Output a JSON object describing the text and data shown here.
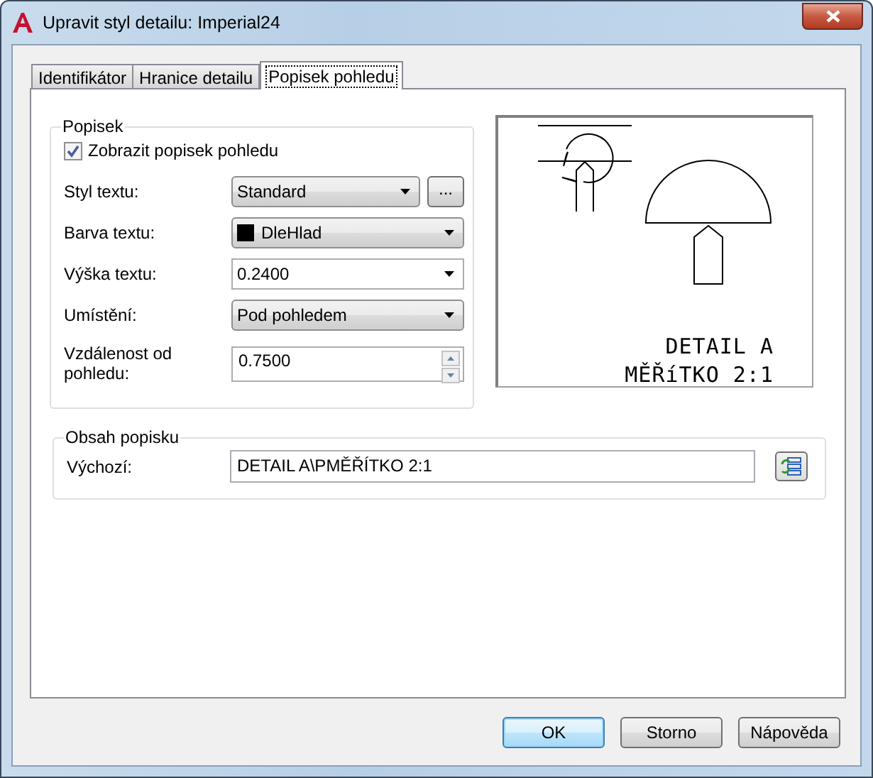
{
  "window": {
    "title": "Upravit styl detailu: Imperial24"
  },
  "tabs": [
    {
      "label": "Identifikátor",
      "selected": false
    },
    {
      "label": "Hranice detailu",
      "selected": false
    },
    {
      "label": "Popisek pohledu",
      "selected": true
    }
  ],
  "label_group": {
    "title": "Popisek",
    "show_label": {
      "label": "Zobrazit popisek pohledu",
      "checked": true
    },
    "rows": [
      {
        "kind": "combo",
        "label": "Styl textu:",
        "value": "Standard",
        "browse_button": "..."
      },
      {
        "kind": "combo",
        "label": "Barva textu:",
        "value": "DleHlad",
        "color": "#000000"
      },
      {
        "kind": "editable-combo",
        "label": "Výška textu:",
        "value": "0.2400"
      },
      {
        "kind": "combo",
        "label": "Umístění:",
        "value": "Pod pohledem"
      },
      {
        "kind": "spinner",
        "label": "Vzdálenost od pohledu:",
        "value": "0.7500"
      }
    ]
  },
  "preview": {
    "lines": [
      "DETAIL A",
      "MĚŘíTKO 2:1"
    ]
  },
  "content_group": {
    "title": "Obsah popisku",
    "label": "Výchozí:",
    "value": "DETAIL A\\PMĚŘÍTKO 2:1"
  },
  "buttons": [
    {
      "label": "OK",
      "default": true
    },
    {
      "label": "Storno",
      "default": false
    },
    {
      "label": "Nápověda",
      "default": false
    }
  ]
}
